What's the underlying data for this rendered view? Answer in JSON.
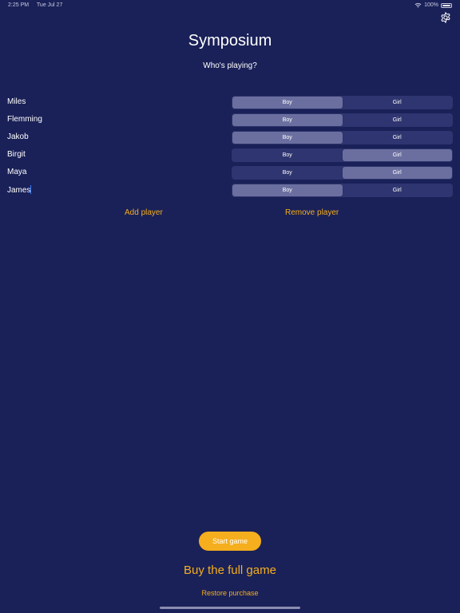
{
  "status_bar": {
    "time": "2:25 PM",
    "date": "Tue Jul 27",
    "battery": "100%"
  },
  "header": {
    "title": "Symposium",
    "subtitle": "Who's playing?"
  },
  "gender_options": {
    "boy": "Boy",
    "girl": "Girl"
  },
  "players": [
    {
      "name": "Miles",
      "selected": "boy"
    },
    {
      "name": "Flemming",
      "selected": "boy"
    },
    {
      "name": "Jakob",
      "selected": "boy"
    },
    {
      "name": "Birgit",
      "selected": "girl"
    },
    {
      "name": "Maya",
      "selected": "girl"
    },
    {
      "name": "James",
      "selected": "boy"
    }
  ],
  "actions": {
    "add_player": "Add player",
    "remove_player": "Remove player",
    "start_game": "Start game",
    "buy_full_game": "Buy the full game",
    "restore_purchase": "Restore purchase"
  },
  "colors": {
    "background": "#1a2158",
    "accent": "#f5ae1d",
    "segment_track": "#2f3570",
    "segment_selected": "#6b6fa0",
    "text_cursor": "#3a7bff"
  },
  "icons": {
    "settings": "gear-icon",
    "wifi": "wifi-icon",
    "battery": "battery-icon"
  }
}
